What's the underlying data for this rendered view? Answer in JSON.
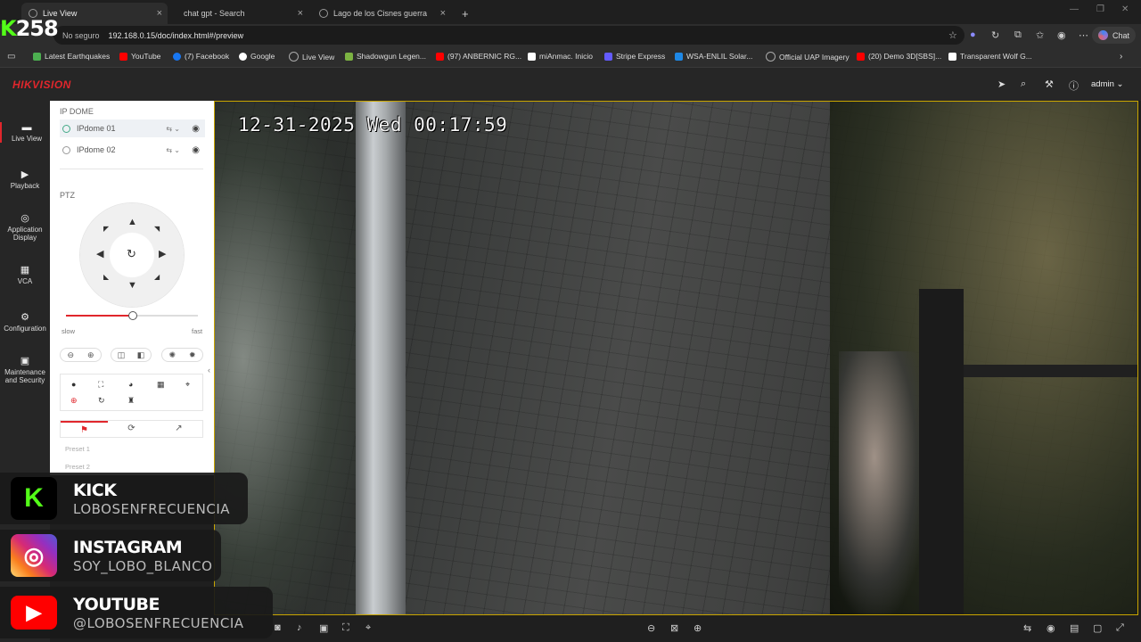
{
  "browser": {
    "tabs": [
      {
        "label": "Live View"
      },
      {
        "label": "chat gpt - Search"
      },
      {
        "label": "Lago de los Cisnes guerra"
      }
    ],
    "address": {
      "security": "No seguro",
      "url": "192.168.0.15/doc/index.html#/preview"
    },
    "chat_label": "Chat",
    "bookmarks": [
      {
        "label": "Latest Earthquakes",
        "color": "#4caf50"
      },
      {
        "label": "YouTube",
        "color": "#ff0000"
      },
      {
        "label": "(7) Facebook",
        "color": "#1877f2"
      },
      {
        "label": "Google",
        "color": "#ffffff"
      },
      {
        "label": "Live View",
        "color": "#aaaaaa"
      },
      {
        "label": "Shadowgun Legen...",
        "color": "#7cb342"
      },
      {
        "label": "(97) ANBERNIC RG...",
        "color": "#ff0000"
      },
      {
        "label": "miAnmac. Inicio",
        "color": "#ffffff"
      },
      {
        "label": "Stripe Express",
        "color": "#635bff"
      },
      {
        "label": "WSA-ENLIL Solar...",
        "color": "#1e88e5"
      },
      {
        "label": "Official UAP Imagery",
        "color": "#aaaaaa"
      },
      {
        "label": "(20) Demo 3D[SBS]...",
        "color": "#ff0000"
      },
      {
        "label": "Transparent Wolf G...",
        "color": "#ffffff"
      }
    ]
  },
  "header": {
    "logo": "HIKVISION",
    "user": "admin"
  },
  "nav": [
    {
      "label": "Live View",
      "icon": "live-view-icon"
    },
    {
      "label": "Playback",
      "icon": "playback-icon"
    },
    {
      "label": "Application Display",
      "icon": "application-icon"
    },
    {
      "label": "VCA",
      "icon": "vca-icon"
    },
    {
      "label": "Configuration",
      "icon": "gear-icon"
    },
    {
      "label": "Maintenance and Security",
      "icon": "maintenance-icon"
    }
  ],
  "panel": {
    "section_title": "IP DOME",
    "cameras": [
      {
        "label": "IPdome 01"
      },
      {
        "label": "IPdome 02"
      }
    ],
    "ptz_title": "PTZ",
    "speed": {
      "slow": "slow",
      "fast": "fast",
      "value": 0.5
    },
    "presets": [
      "Preset 1",
      "Preset 2"
    ]
  },
  "video": {
    "osd": "12-31-2025 Wed 00:17:59"
  },
  "overlay": {
    "counter_k": "K",
    "counter_num": "258",
    "socials": [
      {
        "title": "KICK",
        "handle": "LOBOSENFRECUENCIA",
        "color": "#53fc18"
      },
      {
        "title": "INSTAGRAM",
        "handle": "SOY_LOBO_BLANCO",
        "color": "#d6249f"
      },
      {
        "title": "YOUTUBE",
        "handle": "@LOBOSENFRECUENCIA",
        "color": "#ff0000"
      }
    ]
  }
}
